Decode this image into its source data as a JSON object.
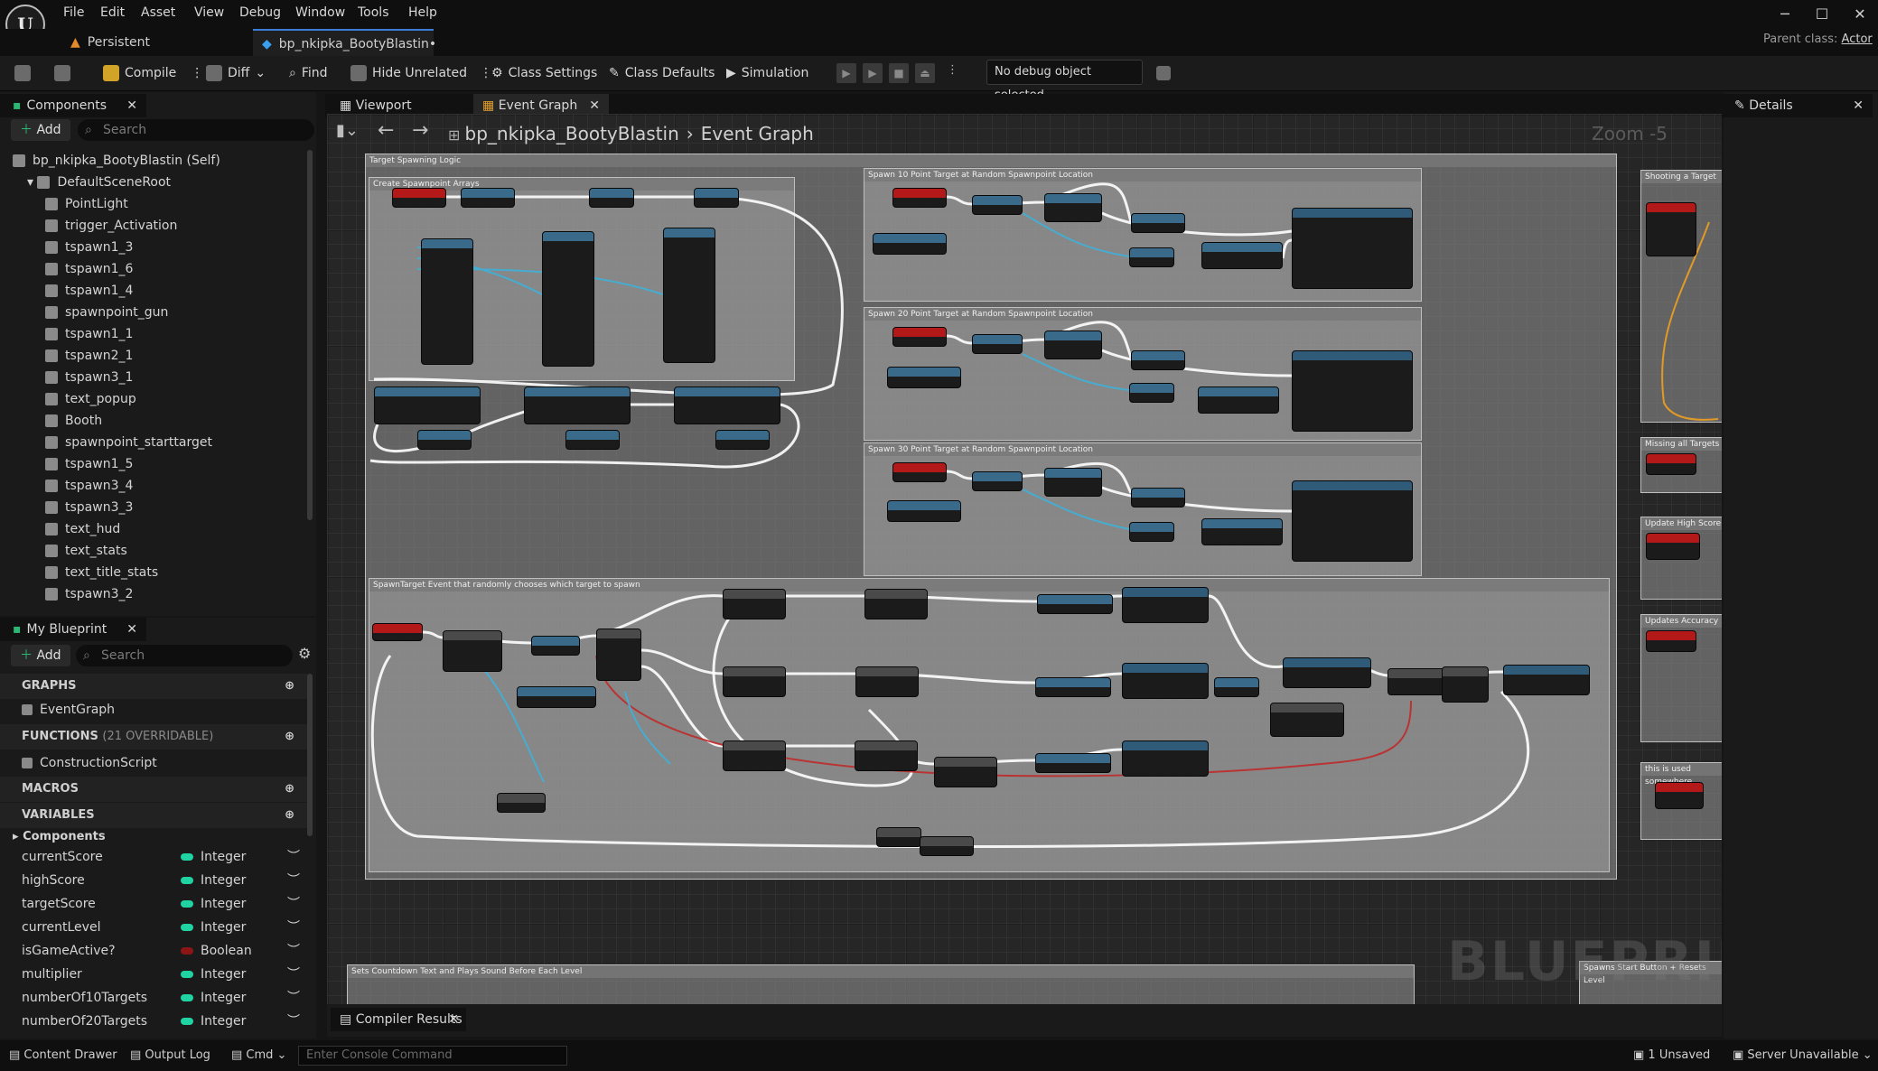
{
  "menu": [
    "File",
    "Edit",
    "Asset",
    "View",
    "Debug",
    "Window",
    "Tools",
    "Help"
  ],
  "tabs": {
    "persistent": "Persistent",
    "blueprint": "bp_nkipka_BootyBlastin•"
  },
  "parent_class": {
    "label": "Parent class:",
    "value": "Actor"
  },
  "toolbar": {
    "compile": "Compile",
    "diff": "Diff",
    "find": "Find",
    "hide_unrelated": "Hide Unrelated",
    "class_settings": "Class Settings",
    "class_defaults": "Class Defaults",
    "simulation": "Simulation",
    "debug_object": "No debug object selected"
  },
  "components": {
    "title": "Components",
    "add": "Add",
    "search_placeholder": "Search",
    "items": [
      "bp_nkipka_BootyBlastin (Self)",
      "DefaultSceneRoot",
      "PointLight",
      "trigger_Activation",
      "tspawn1_3",
      "tspawn1_6",
      "tspawn1_4",
      "spawnpoint_gun",
      "tspawn1_1",
      "tspawn2_1",
      "tspawn3_1",
      "text_popup",
      "Booth",
      "spawnpoint_starttarget",
      "tspawn1_5",
      "tspawn3_4",
      "tspawn3_3",
      "text_hud",
      "text_stats",
      "text_title_stats",
      "tspawn3_2"
    ]
  },
  "my_blueprint": {
    "title": "My Blueprint",
    "add": "Add",
    "search_placeholder": "Search",
    "graphs": "GRAPHS",
    "event_graph": "EventGraph",
    "functions": "FUNCTIONS",
    "functions_note": "(21 OVERRIDABLE)",
    "construction_script": "ConstructionScript",
    "macros": "MACROS",
    "variables": "VARIABLES",
    "components_cat": "Components",
    "variables_list": [
      {
        "name": "currentScore",
        "type": "Integer",
        "color": "#1fd3a3"
      },
      {
        "name": "highScore",
        "type": "Integer",
        "color": "#1fd3a3"
      },
      {
        "name": "targetScore",
        "type": "Integer",
        "color": "#1fd3a3"
      },
      {
        "name": "currentLevel",
        "type": "Integer",
        "color": "#1fd3a3"
      },
      {
        "name": "isGameActive?",
        "type": "Boolean",
        "color": "#8c1616"
      },
      {
        "name": "multiplier",
        "type": "Integer",
        "color": "#1fd3a3"
      },
      {
        "name": "numberOf10Targets",
        "type": "Integer",
        "color": "#1fd3a3"
      },
      {
        "name": "numberOf20Targets",
        "type": "Integer",
        "color": "#1fd3a3"
      }
    ]
  },
  "graph_tabs": {
    "viewport": "Viewport",
    "event_graph": "Event Graph"
  },
  "breadcrumb": {
    "blueprint": "bp_nkipka_BootyBlastin",
    "graph": "Event Graph"
  },
  "zoom": "Zoom -5",
  "watermark": "BLUEPRINT",
  "details": {
    "title": "Details"
  },
  "comments": {
    "target_spawning": "Target Spawning Logic",
    "create_arrays": "Create Spawnpoint Arrays",
    "spawn10": "Spawn 10 Point Target at Random Spawnpoint Location",
    "spawn20": "Spawn 20 Point Target at Random Spawnpoint Location",
    "spawn30": "Spawn 30 Point Target at Random Spawnpoint Location",
    "spawn_event": "SpawnTarget Event that randomly chooses which target to spawn",
    "countdown": "Sets Countdown Text and Plays Sound Before Each Level",
    "shooting": "Shooting a Target",
    "missing": "Missing all Targets",
    "highscore": "Update High Score",
    "accuracy": "Updates Accuracy",
    "game_used": "this is used somewhere",
    "start_button": "Spawns Start Button + Resets Level"
  },
  "bottom": {
    "compiler_results": "Compiler Results",
    "content_drawer": "Content Drawer",
    "output_log": "Output Log",
    "cmd": "Cmd",
    "console_placeholder": "Enter Console Command",
    "unsaved": "1 Unsaved",
    "server": "Server Unavailable"
  }
}
